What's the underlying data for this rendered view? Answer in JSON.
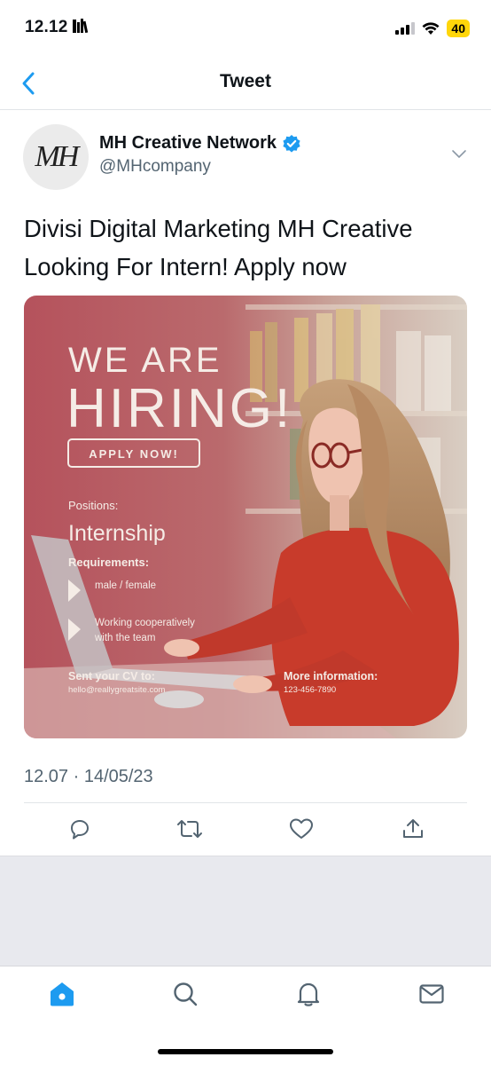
{
  "status_bar": {
    "time": "12.12",
    "battery": "40"
  },
  "nav": {
    "title": "Tweet"
  },
  "author": {
    "avatar_text": "MH",
    "name": "MH Creative Network",
    "handle": "@MHcompany"
  },
  "tweet": {
    "text": "Divisi Digital Marketing MH Creative Looking For Intern! Apply now",
    "timestamp": "12.07 · 14/05/23"
  },
  "media": {
    "headline_1": "WE ARE",
    "headline_2": "HIRING!",
    "apply_button": "APPLY NOW!",
    "positions_label": "Positions:",
    "position": "Internship",
    "requirements_label": "Requirements:",
    "requirement_1": "male / female",
    "requirement_2a": "Working cooperatively",
    "requirement_2b": "with the team",
    "cv_label": "Sent your CV to:",
    "cv_email": "hello@reallygreatsite.com",
    "info_label": "More information:",
    "info_phone": "123-456-7890"
  },
  "actions": [
    "reply-icon",
    "retweet-icon",
    "like-icon",
    "share-icon"
  ],
  "tabs": [
    "home-icon",
    "search-icon",
    "notifications-icon",
    "messages-icon"
  ],
  "colors": {
    "accent": "#1d9bf0",
    "poster": "#b5575f"
  }
}
